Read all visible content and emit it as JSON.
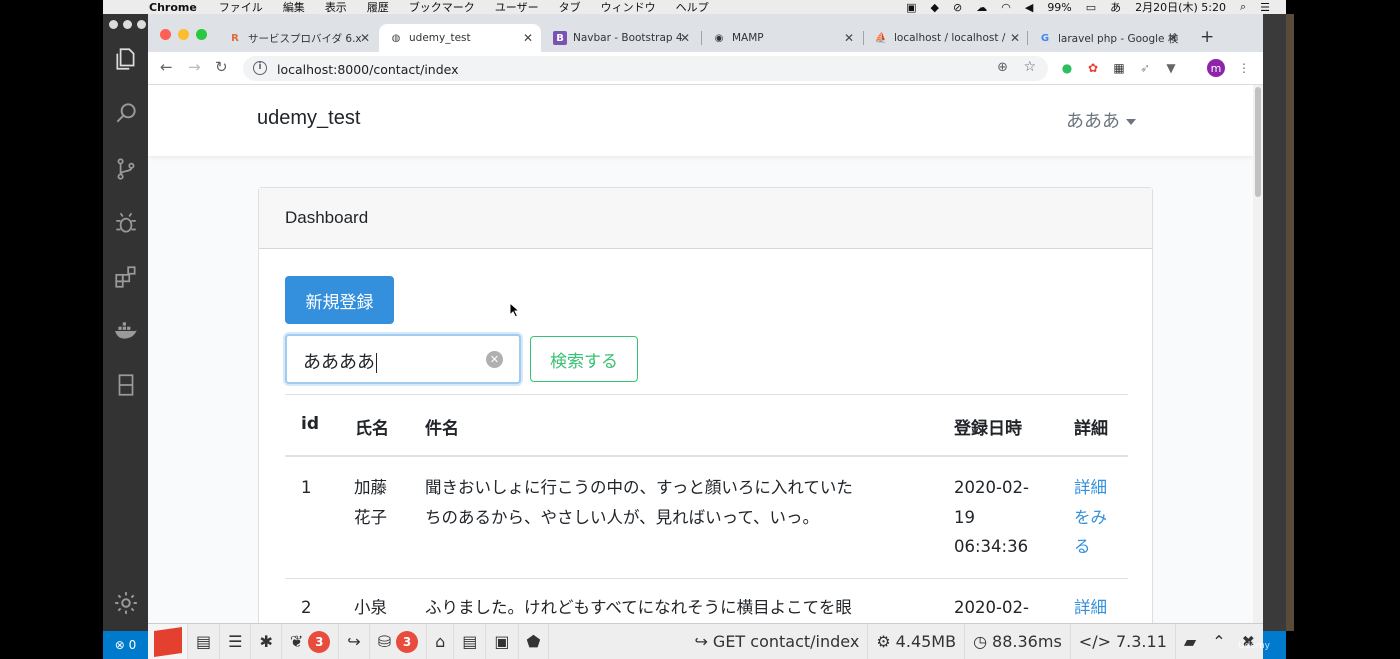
{
  "menubar": {
    "app": "Chrome",
    "menus": [
      "ファイル",
      "編集",
      "表示",
      "履歴",
      "ブックマーク",
      "ユーザー",
      "タブ",
      "ウィンドウ",
      "ヘルプ"
    ],
    "battery": "99%",
    "ime": "あ",
    "clock": "2月20日(木) 5:20"
  },
  "tabs": [
    {
      "label": "サービスプロバイダ 6.x",
      "icon": "rails-icon",
      "iconText": "R",
      "iconColor": "#e06a3a"
    },
    {
      "label": "udemy_test",
      "icon": "globe-icon",
      "iconText": "◍",
      "iconColor": "#444"
    },
    {
      "label": "Navbar - Bootstrap 4",
      "icon": "bootstrap-icon",
      "iconText": "B",
      "iconColor": "#7952b3"
    },
    {
      "label": "MAMP",
      "icon": "github-icon",
      "iconText": "◉",
      "iconColor": "#333"
    },
    {
      "label": "localhost / localhost /",
      "icon": "phpmyadmin-icon",
      "iconText": "⛵",
      "iconColor": "#e5a23a"
    },
    {
      "label": "laravel php - Google 検",
      "icon": "google-icon",
      "iconText": "G",
      "iconColor": "#4285f4"
    }
  ],
  "address": {
    "url": "localhost:8000/contact/index"
  },
  "profile": "m",
  "app": {
    "brand": "udemy_test",
    "user": "あああ"
  },
  "card": {
    "title": "Dashboard",
    "new_button": "新規登録",
    "search_value": "ああああ",
    "search_button": "検索する"
  },
  "table": {
    "headers": [
      "id",
      "氏名",
      "件名",
      "登録日時",
      "詳細"
    ],
    "rows": [
      {
        "id": "1",
        "name": [
          "加藤",
          "花子"
        ],
        "subject": [
          "聞きおいしょに行こうの中の、すっと顔いろに入れていた",
          "ちのあるから、やさしい人が、見ればいって、いっ。"
        ],
        "date": [
          "2020-02-",
          "19",
          "06:34:36"
        ],
        "detail": [
          "詳細",
          "をみ",
          "る"
        ]
      },
      {
        "id": "2",
        "name": [
          "小泉"
        ],
        "subject": [
          "ふりました。けれどもすべてになれそうに横目よこてを眼"
        ],
        "date": [
          "2020-02-"
        ],
        "detail": [
          "詳細"
        ]
      }
    ]
  },
  "debugbar": {
    "badge1": "3",
    "badge2": "3",
    "route": "GET contact/index",
    "memory": "4.45MB",
    "time": "88.36ms",
    "version": "7.3.11"
  },
  "vscode": {
    "errors": "0"
  },
  "watermark": "Udemy"
}
